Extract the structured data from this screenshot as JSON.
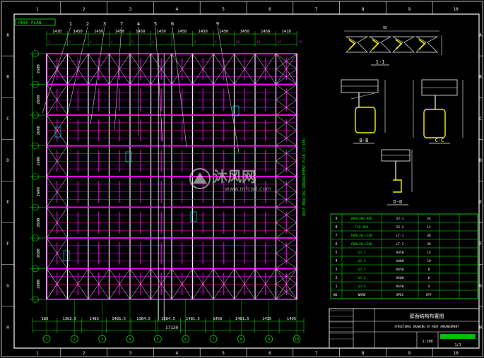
{
  "colors": {
    "background": "#000000",
    "frame": "#ffffff",
    "purlin": "#ff00ff",
    "grid": "#ffffff",
    "dimension": "#00ff00",
    "annotation": "#00ffff",
    "detail": "#ffff00",
    "title_accent": "#00c000"
  },
  "border": {
    "top_numbers": [
      "1",
      "2",
      "3",
      "4",
      "5",
      "6",
      "7",
      "8",
      "9",
      "10"
    ],
    "left_letters": [
      "A",
      "B",
      "C",
      "D",
      "E",
      "F",
      "G",
      "H"
    ]
  },
  "drawing_tag": "ROOF PLAN",
  "plan": {
    "top_dims": [
      "1410",
      "1450",
      "1450",
      "1450",
      "1450",
      "1450",
      "1450",
      "1450",
      "1450",
      "1450",
      "1450",
      "1410"
    ],
    "column_letters": [
      "1",
      "2",
      "3",
      "4",
      "5",
      "6",
      "7",
      "8",
      "9",
      "10",
      "11",
      "12",
      "13"
    ],
    "leader_labels": [
      "1",
      "2",
      "3",
      "7",
      "4",
      "5",
      "6",
      "9"
    ],
    "left_dims": [
      "2600",
      "2600",
      "2600",
      "2600",
      "2600",
      "2600",
      "2600",
      "2600"
    ],
    "bottom_dims": [
      "180",
      "1362.5",
      "1483",
      "1481.5",
      "1384.5",
      "1384.5",
      "1481.5",
      "1450",
      "1481.5",
      "1435",
      "1405"
    ],
    "bottom_total": "17120",
    "axis_bubbles": [
      "1",
      "2",
      "3",
      "4",
      "5",
      "6",
      "7",
      "8",
      "9",
      "10"
    ],
    "vertical_note": "ROOF BRACING ARRANGEMENT PLAN  (1:100)"
  },
  "details": {
    "top_label": "1-1",
    "b_label": "B-B",
    "c_label": "C-C",
    "d_label": "D-D",
    "top_dim": "95"
  },
  "watermark": {
    "brand": "沐风网",
    "url": "www.mfcad.com"
  },
  "table": {
    "rows": [
      {
        "no": "9",
        "name": "BRACING ROD",
        "spec": "ZJ-1",
        "qty": "24"
      },
      {
        "no": "8",
        "name": "TIE BAR",
        "spec": "ZJ-2",
        "qty": "12"
      },
      {
        "no": "7",
        "name": "PURLIN C160",
        "spec": "LT-1",
        "qty": "48"
      },
      {
        "no": "6",
        "name": "PURLIN C200",
        "spec": "LT-2",
        "qty": "36"
      },
      {
        "no": "5",
        "name": "GJ-1",
        "spec": "H350",
        "qty": "14"
      },
      {
        "no": "4",
        "name": "GJ-2",
        "spec": "H400",
        "qty": "10"
      },
      {
        "no": "3",
        "name": "GJ-3",
        "spec": "H450",
        "qty": "8"
      },
      {
        "no": "2",
        "name": "GJ-4",
        "spec": "H500",
        "qty": "6"
      },
      {
        "no": "1",
        "name": "GJ-5",
        "spec": "H550",
        "qty": "4"
      }
    ],
    "header": {
      "no": "NO.",
      "name": "NAME",
      "spec": "SPEC",
      "qty": "QTY"
    }
  },
  "title_block": {
    "title_cn": "屋面结构布置图",
    "title_en": "STRUCTURAL DRAWING OF ROOF ARRANGEMENT",
    "scale": "1:100",
    "sheet": "1/1"
  }
}
